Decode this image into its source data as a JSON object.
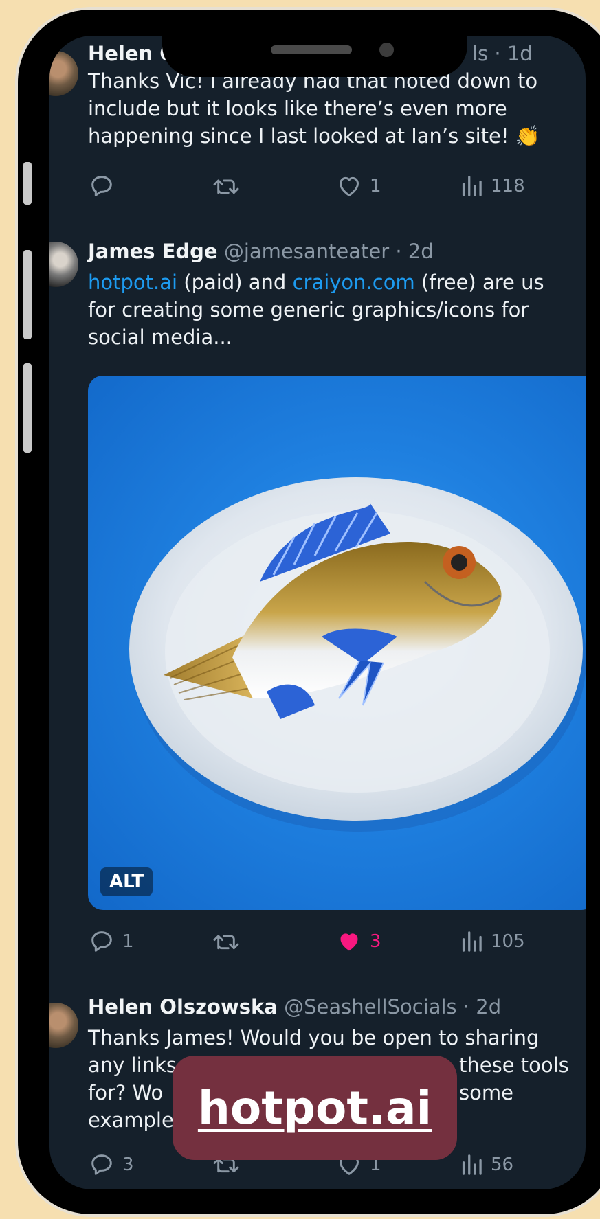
{
  "tweets": [
    {
      "name": "Helen O",
      "meta": "ls · 1d",
      "lines": [
        "Thanks Vic! I already had that noted down to",
        "include but it looks like there’s even more",
        "happening since I last looked at Ian’s site! 👏"
      ],
      "actions": {
        "reply": "",
        "retweet": "",
        "like": "1",
        "views": "118"
      }
    },
    {
      "name": "James Edge",
      "meta": "@jamesanteater · 2d",
      "line1": {
        "link1": "hotpot.ai",
        "mid": " (paid) and ",
        "link2": "craiyon.com",
        "end": " (free) are us"
      },
      "lines": [
        "for creating some generic graphics/icons for",
        "social media..."
      ],
      "media_badge": "ALT",
      "actions": {
        "reply": "1",
        "retweet": "",
        "like": "3",
        "views": "105"
      }
    },
    {
      "name": "Helen Olszowska",
      "meta": "@SeashellSocials · 2d",
      "lines": [
        "Thanks James! Would you be open to sharing",
        "any links",
        "for? Wo",
        "example"
      ],
      "line_ends": [
        "",
        "these tools",
        "some",
        ""
      ],
      "actions": {
        "reply": "3",
        "retweet": "",
        "like": "1",
        "views": "56"
      }
    }
  ],
  "overlay_label": "hotpot.ai",
  "colors": {
    "background": "#f6dfb0",
    "screen": "#15202b",
    "link": "#1d9bf0",
    "like_active": "#f91880",
    "overlay": "#74303f"
  }
}
